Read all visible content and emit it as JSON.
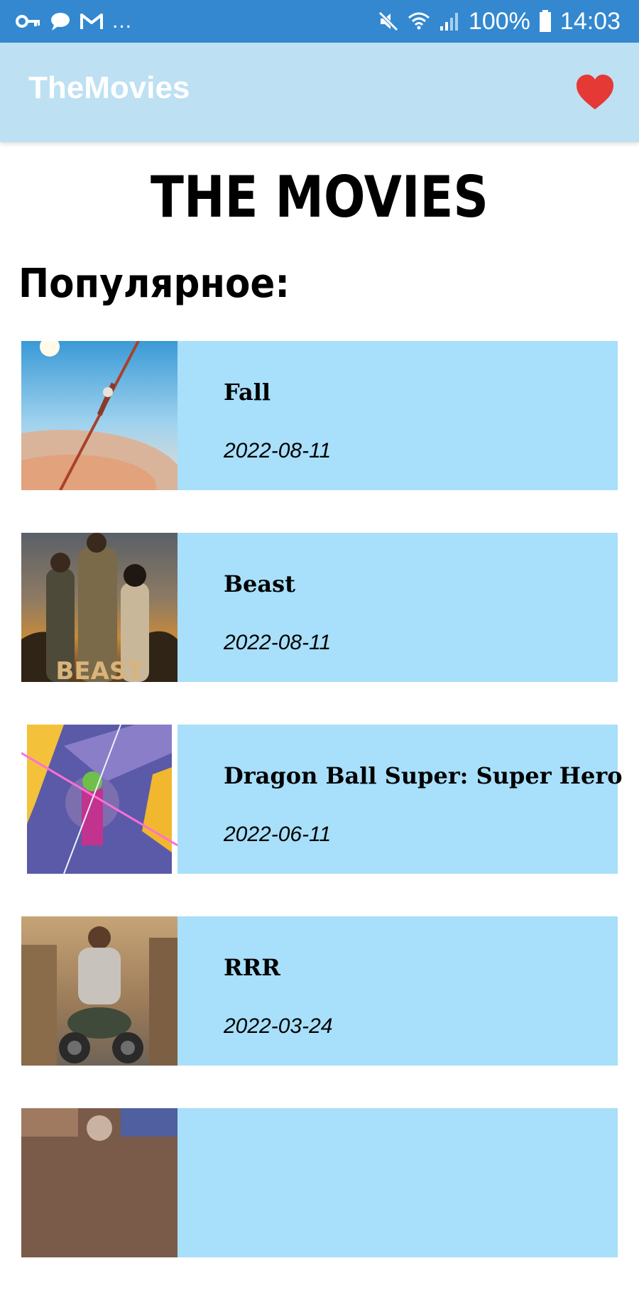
{
  "status_bar": {
    "left_icons": [
      "key-icon",
      "chat-bubble-icon",
      "gmail-icon"
    ],
    "overflow": "...",
    "right_icons": [
      "mute-icon",
      "wifi-icon",
      "signal-icon",
      "battery-icon"
    ],
    "battery": "100%",
    "time": "14:03"
  },
  "app_bar": {
    "title": "TheMovies",
    "favorites_icon": "heart-icon",
    "favorites_color": "#e53935",
    "background": "#bde0f3"
  },
  "main": {
    "heading": "THE MOVIES",
    "section_title": "Популярное:",
    "movies": [
      {
        "title": "Fall",
        "date": "2022-08-11",
        "poster": "poster-fall"
      },
      {
        "title": "Beast",
        "date": "2022-08-11",
        "poster": "poster-beast"
      },
      {
        "title": "Dragon Ball Super: Super Hero",
        "date": "2022-06-11",
        "poster": "poster-dragon-ball"
      },
      {
        "title": "RRR",
        "date": "2022-03-24",
        "poster": "poster-rrr"
      }
    ],
    "card_color": "#a8dffa"
  }
}
